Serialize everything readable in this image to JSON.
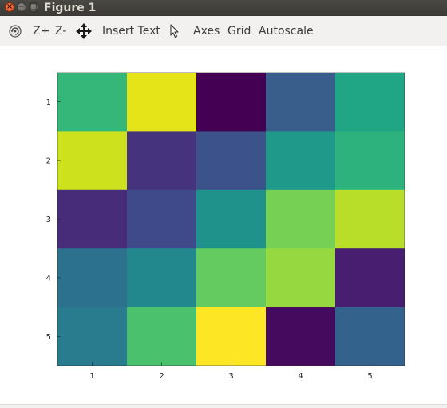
{
  "window": {
    "title": "Figure 1",
    "close_glyph": "×",
    "min_glyph": "−",
    "max_glyph": "□"
  },
  "toolbar": {
    "rotate_icon": "rotate-icon",
    "zoom_in": "Z+",
    "zoom_out": "Z-",
    "pan_icon": "pan-arrows-icon",
    "insert_text": "Insert Text",
    "select_icon": "pointer-arrow-icon",
    "axes": "Axes",
    "grid": "Grid",
    "autoscale": "Autoscale"
  },
  "chart_data": {
    "type": "heatmap",
    "colormap": "viridis",
    "x_ticks": [
      "1",
      "2",
      "3",
      "4",
      "5"
    ],
    "y_ticks": [
      "1",
      "2",
      "3",
      "4",
      "5"
    ],
    "cell_colors": [
      [
        "#35b779",
        "#e5e419",
        "#440154",
        "#3a5e8c",
        "#21a685"
      ],
      [
        "#cde11d",
        "#46337e",
        "#3b528b",
        "#1f998a",
        "#2db27d"
      ],
      [
        "#472c7a",
        "#3e4a89",
        "#20928c",
        "#75d054",
        "#b8de29"
      ],
      [
        "#2c728e",
        "#23888e",
        "#63cb5f",
        "#95d840",
        "#481f70"
      ],
      [
        "#287c8e",
        "#4ac16d",
        "#fde725",
        "#450a5d",
        "#33638d"
      ]
    ],
    "grid": false
  }
}
